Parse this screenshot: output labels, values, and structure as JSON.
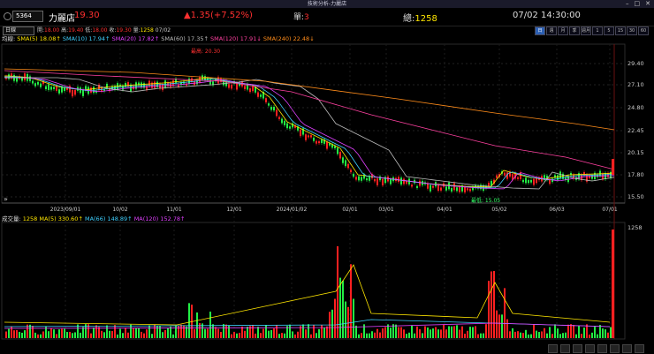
{
  "window": {
    "title": "技術分析-力麗店"
  },
  "quote": {
    "code": "5364",
    "name": "力麗店",
    "price": "19.30",
    "change": "▲1.35(+7.52%)",
    "lot_label": "單:",
    "lot_value": "3",
    "volume_label": "總:",
    "volume_value": "1258",
    "datetime": "07/02 14:30:00"
  },
  "ohlc": {
    "period": "日線",
    "open_label": "開:",
    "open": "18.00",
    "high_label": "高:",
    "high": "19.40",
    "low_label": "低:",
    "low": "18.00",
    "close_label": "收:",
    "close": "19.30",
    "vol_label": "量:",
    "vol": "1258",
    "date": "07/02"
  },
  "period_buttons": [
    "日",
    "週",
    "月",
    "季",
    "週月",
    "1",
    "5",
    "15",
    "30",
    "60"
  ],
  "ma_legend": {
    "label": "均線",
    "items": [
      {
        "text": "SMA(5) 18.08↑",
        "color": "#ffe600"
      },
      {
        "text": "SMA(10) 17.94↑",
        "color": "#3fd0ff"
      },
      {
        "text": "SMA(20) 17.82↑",
        "color": "#e040ff"
      },
      {
        "text": "SMA(60) 17.35↑",
        "color": "#bbbbbb"
      },
      {
        "text": "SMA(120) 17.91↓",
        "color": "#ff40a0"
      },
      {
        "text": "SMA(240) 22.48↓",
        "color": "#ff8c1a"
      }
    ]
  },
  "vol_legend": {
    "label": "成交量",
    "items": [
      {
        "text": "1258",
        "color": "#ffe600"
      },
      {
        "text": "MA(5) 330.60↑",
        "color": "#ffe600"
      },
      {
        "text": "MA(66) 148.89↑",
        "color": "#3fd0ff"
      },
      {
        "text": "MA(120) 152.78↑",
        "color": "#e040ff"
      }
    ]
  },
  "annotations": {
    "high": "最高: 20.30",
    "low": "最低: 15.05"
  },
  "price_axis": [
    "29.40",
    "27.10",
    "24.80",
    "22.45",
    "20.15",
    "17.80",
    "15.50"
  ],
  "volume_axis": [
    "1258"
  ],
  "x_axis": [
    "2023/09/01",
    "10/02",
    "11/01",
    "12/01",
    "2024/01/02",
    "02/01",
    "03/01",
    "04/01",
    "05/02",
    "06/03",
    "07/01"
  ],
  "icons": {
    "expand": "»"
  }
}
